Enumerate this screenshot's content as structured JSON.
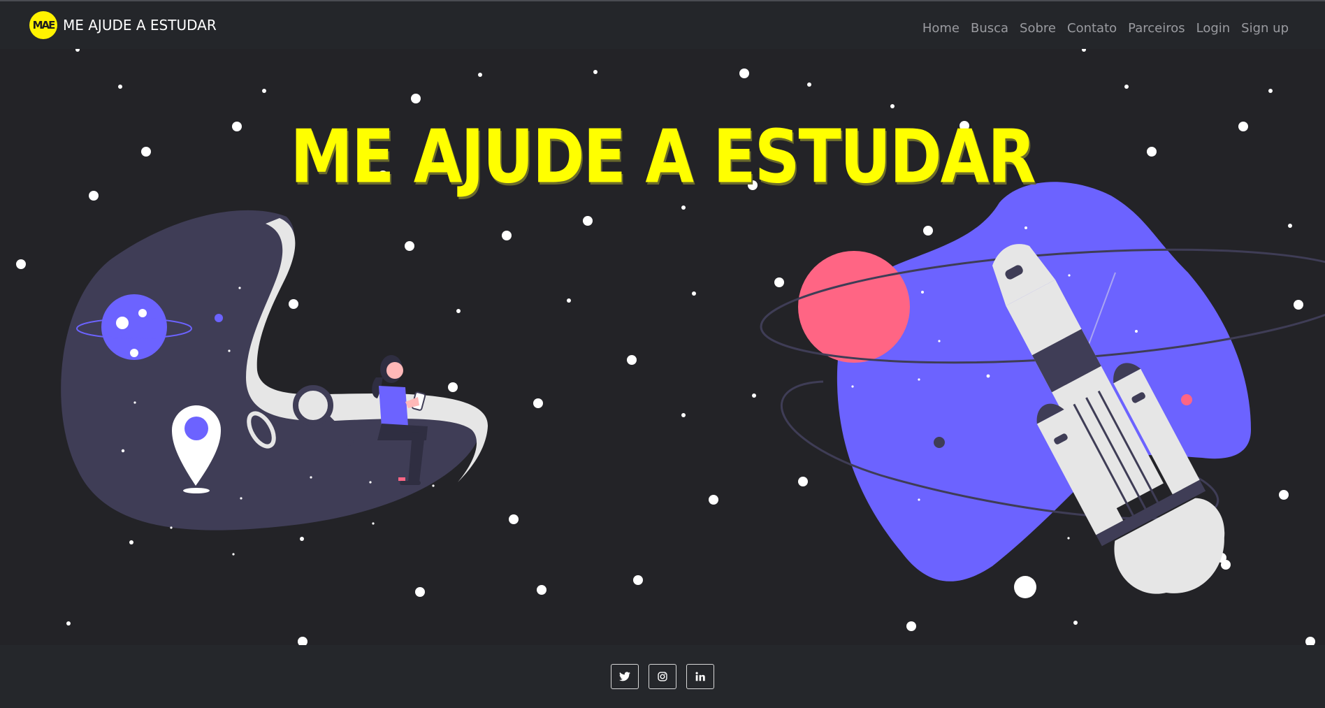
{
  "brand": {
    "logo_text": "MAE",
    "name": "ME AJUDE A ESTUDAR"
  },
  "nav": {
    "items": [
      "Home",
      "Busca",
      "Sobre",
      "Contato",
      "Parceiros",
      "Login",
      "Sign up"
    ]
  },
  "hero": {
    "title": "ME AJUDE A ESTUDAR"
  },
  "footer": {
    "social": [
      "twitter-icon",
      "instagram-icon",
      "linkedin-icon"
    ]
  },
  "colors": {
    "background": "#232327",
    "title": "#ffff00",
    "accent_purple": "#6c63ff",
    "planet_pink": "#ff6584",
    "blob_dark": "#3f3d56"
  }
}
